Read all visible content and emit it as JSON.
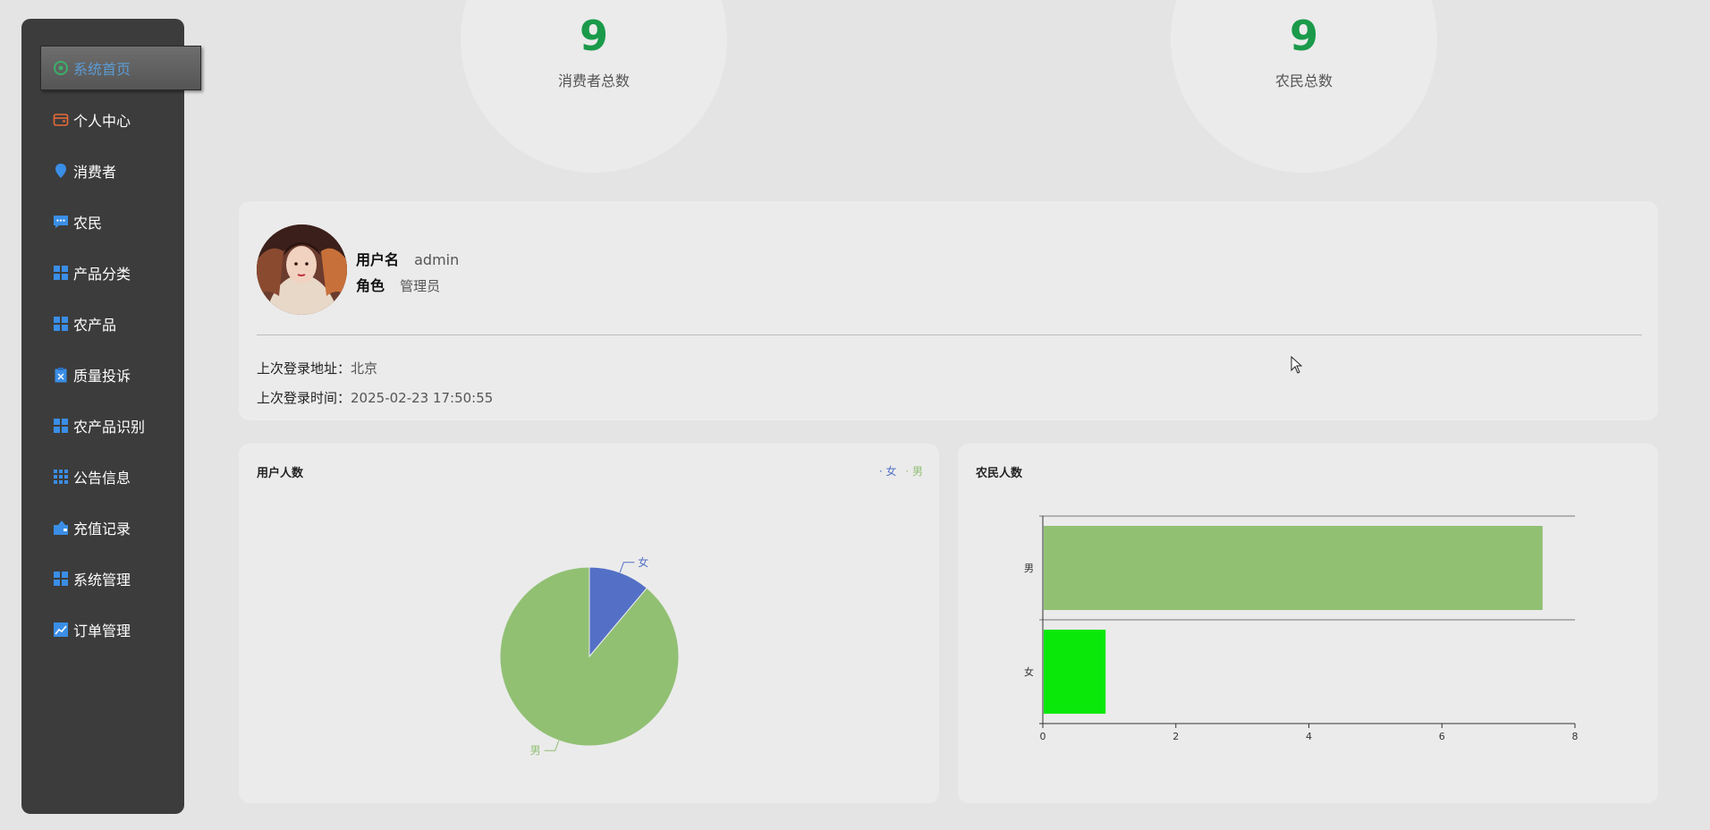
{
  "sidebar": {
    "items": [
      {
        "label": "系统首页",
        "icon": "home-icon"
      },
      {
        "label": "个人中心",
        "icon": "wallet-icon"
      },
      {
        "label": "消费者",
        "icon": "pin-icon"
      },
      {
        "label": "农民",
        "icon": "chat-icon"
      },
      {
        "label": "产品分类",
        "icon": "grid-icon"
      },
      {
        "label": "农产品",
        "icon": "grid-icon"
      },
      {
        "label": "质量投诉",
        "icon": "clipboard-icon"
      },
      {
        "label": "农产品识别",
        "icon": "grid-icon"
      },
      {
        "label": "公告信息",
        "icon": "apps-icon"
      },
      {
        "label": "充值记录",
        "icon": "recharge-icon"
      },
      {
        "label": "系统管理",
        "icon": "grid-icon"
      },
      {
        "label": "订单管理",
        "icon": "chart-line-icon"
      }
    ]
  },
  "stats": {
    "consumers": {
      "value": "9",
      "label": "消费者总数"
    },
    "farmers": {
      "value": "9",
      "label": "农民总数"
    }
  },
  "profile": {
    "username_label": "用户名",
    "username": "admin",
    "role_label": "角色",
    "role": "管理员",
    "last_login_addr_label": "上次登录地址：",
    "last_login_addr": "北京",
    "last_login_time_label": "上次登录时间：",
    "last_login_time": "2025-02-23 17:50:55"
  },
  "colors": {
    "accent_green": "#1a9a4a",
    "female": "#5470c6",
    "male": "#91c073",
    "bar_female": "#0ae80a"
  },
  "chart_data": [
    {
      "type": "pie",
      "title": "用户人数",
      "legend": [
        "女",
        "男"
      ],
      "legend_position": "top-right",
      "categories": [
        "女",
        "男"
      ],
      "values": [
        1,
        8
      ]
    },
    {
      "type": "bar",
      "orientation": "horizontal",
      "title": "农民人数",
      "categories": [
        "男",
        "女"
      ],
      "values": [
        7.5,
        0.93
      ],
      "xlim": [
        0,
        8
      ],
      "xticks": [
        "0",
        "2",
        "4",
        "6",
        "8"
      ]
    }
  ]
}
